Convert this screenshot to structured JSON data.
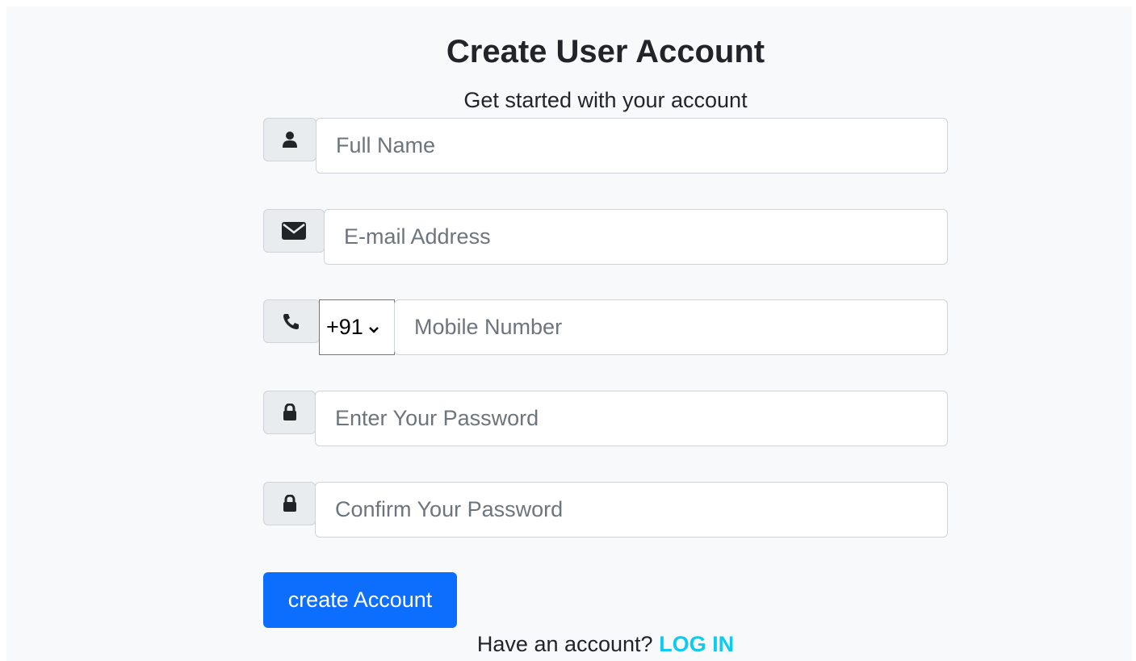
{
  "title": "Create User Account",
  "subtitle": "Get started with your account",
  "fields": {
    "full_name": {
      "icon": "user-icon",
      "placeholder": "Full Name"
    },
    "email": {
      "icon": "envelope-icon",
      "placeholder": "E-mail Address"
    },
    "mobile": {
      "icon": "phone-icon",
      "country_code": "+91",
      "placeholder": "Mobile Number"
    },
    "password": {
      "icon": "lock-icon",
      "placeholder": "Enter Your Password"
    },
    "confirm_password": {
      "icon": "lock-icon",
      "placeholder": "Confirm Your Password"
    }
  },
  "submit_label": "create Account",
  "footer": {
    "prompt": "Have an account?",
    "link_label": "LOG IN"
  },
  "colors": {
    "primary_button": "#0d6efd",
    "link": "#0dcaf0",
    "panel_background": "#f8f9fa"
  }
}
